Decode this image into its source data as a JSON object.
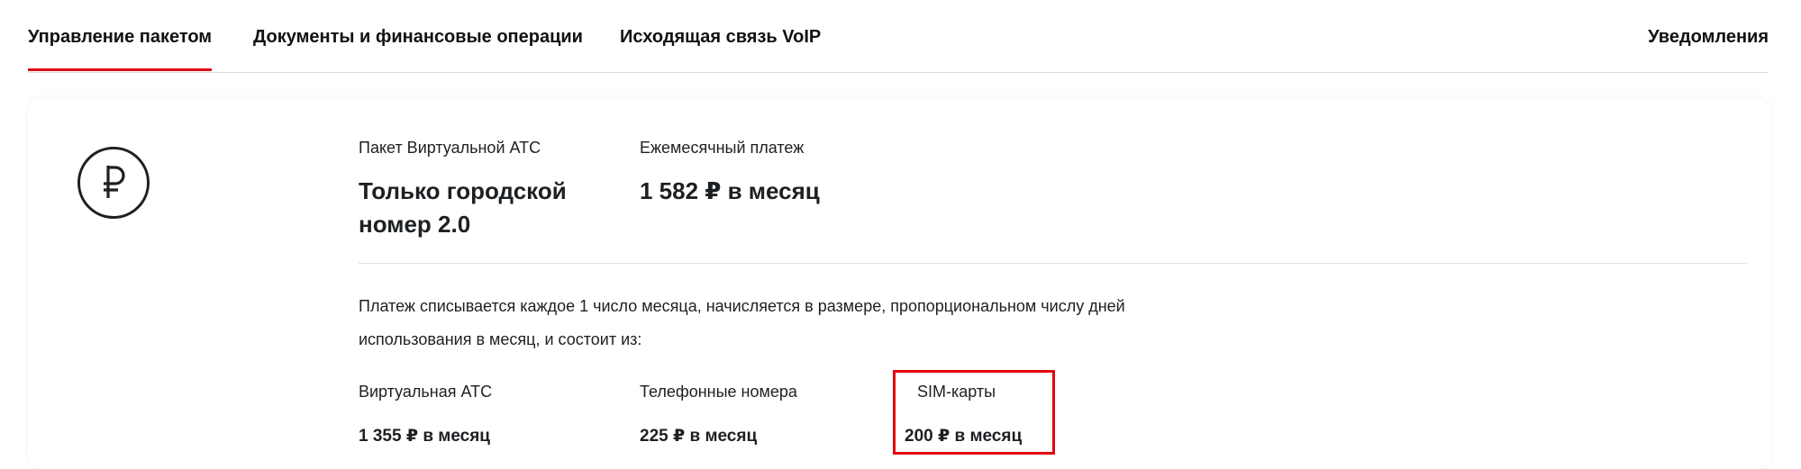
{
  "tabs": {
    "items": [
      {
        "label": "Управление пакетом",
        "active": true
      },
      {
        "label": "Документы и финансовые операции",
        "active": false
      },
      {
        "label": "Исходящая связь VoIP",
        "active": false
      }
    ],
    "notifications_label": "Уведомления"
  },
  "package": {
    "icon": "ruble-icon",
    "name_label": "Пакет Виртуальной АТС",
    "name_value": "Только городской номер 2.0",
    "payment_label": "Ежемесячный платеж",
    "payment_value": "1 582 ₽ в месяц",
    "description": "Платеж списывается каждое 1 число месяца, начисляется в размере, пропорциональном числу дней использования в месяц, и состоит из:"
  },
  "components": [
    {
      "label": "Виртуальная АТС",
      "value": "1 355 ₽ в месяц",
      "highlighted": false
    },
    {
      "label": "Телефонные номера",
      "value": "225 ₽ в месяц",
      "highlighted": false
    },
    {
      "label": "SIM-карты",
      "value": "200 ₽ в месяц",
      "highlighted": true
    }
  ],
  "colors": {
    "accent": "#e30611",
    "text": "#1d2023",
    "divider": "#e2e2e2"
  }
}
